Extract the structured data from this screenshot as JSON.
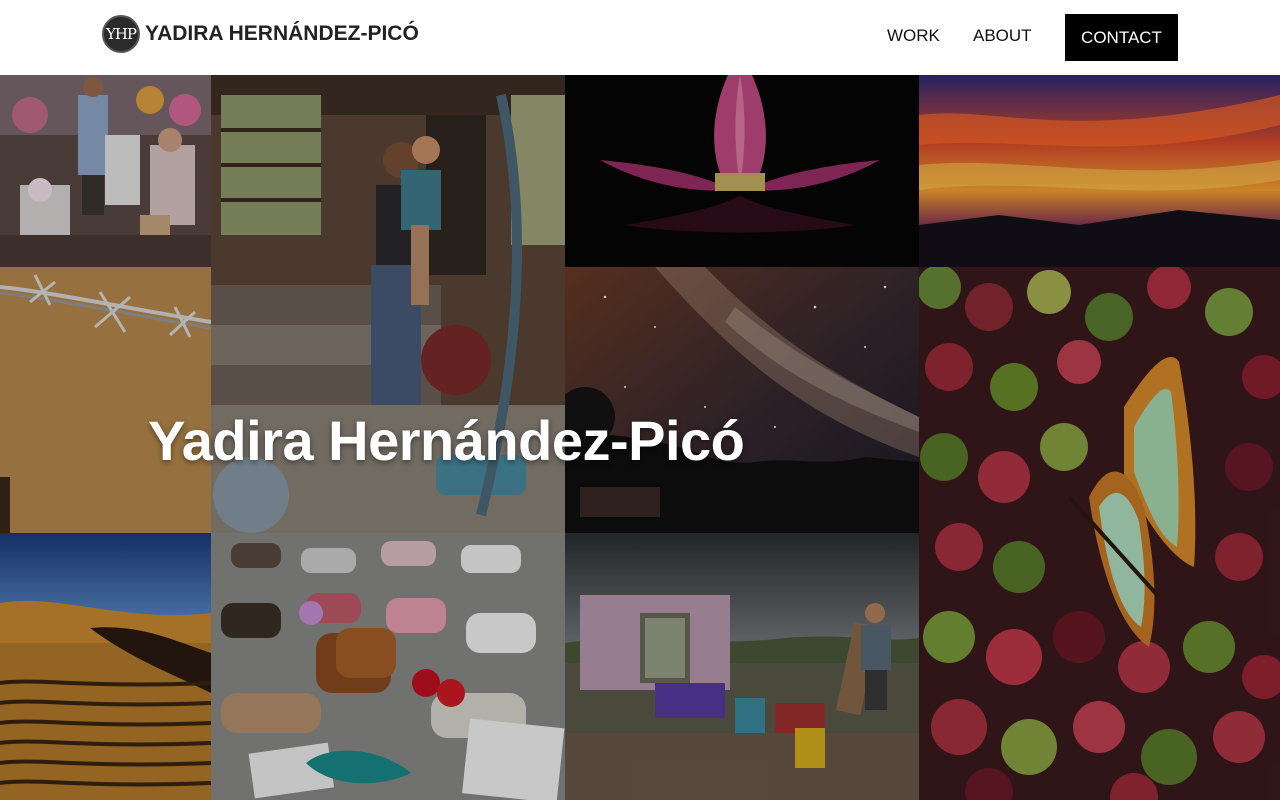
{
  "header": {
    "logo_monogram": "YHP",
    "logo_text": "YADIRA HERNÁNDEZ-PICÓ",
    "nav": {
      "work": "WORK",
      "about": "ABOUT",
      "contact": "CONTACT"
    }
  },
  "hero": {
    "title": "Yadira Hernández-Picó"
  },
  "gallery": {
    "photos": [
      "woman-in-shop-photo",
      "mother-and-child-photo",
      "pink-lotus-photo",
      "sunset-sky-photo",
      "barbed-wire-photo",
      "milky-way-night-photo",
      "butterfly-on-coffee-beans-photo",
      "desert-dunes-photo",
      "shoes-memorial-photo",
      "storm-damaged-house-photo"
    ]
  },
  "colors": {
    "header_bg": "#ffffff",
    "contact_bg": "#000000",
    "hero_text": "#ffffff"
  }
}
